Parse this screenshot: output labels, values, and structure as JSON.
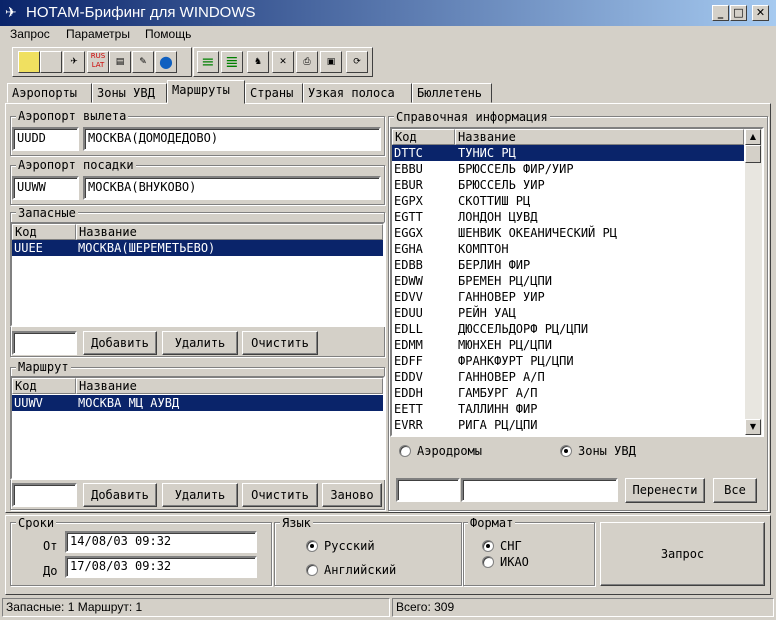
{
  "window": {
    "title": "НОТАМ-Брифинг для WINDOWS",
    "min": "_",
    "max": "□",
    "close": "✕"
  },
  "menu": [
    "Запрос",
    "Параметры",
    "Помощь"
  ],
  "toolbar": [
    {
      "name": "new-icon",
      "glyph": ""
    },
    {
      "name": "save-icon",
      "glyph": ""
    },
    {
      "name": "plane-icon",
      "glyph": "✈"
    },
    {
      "name": "rus-lat-icon",
      "glyph": "RUS LAT"
    },
    {
      "name": "notepad-icon",
      "glyph": "▤"
    },
    {
      "name": "edit-icon",
      "glyph": "✎"
    },
    {
      "name": "globe-icon",
      "glyph": "●"
    },
    {
      "name": "list-green-icon",
      "glyph": "≡"
    },
    {
      "name": "list-green-2-icon",
      "glyph": "≣"
    },
    {
      "name": "chess-icon",
      "glyph": "♞"
    },
    {
      "name": "delete-icon",
      "glyph": "✕"
    },
    {
      "name": "print-icon",
      "glyph": "⎙"
    },
    {
      "name": "disk-icon",
      "glyph": "▣"
    },
    {
      "name": "refresh-icon",
      "glyph": "⟳"
    }
  ],
  "tabs": [
    "Аэропорты",
    "Зоны УВД",
    "Маршруты",
    "Страны",
    "Узкая полоса",
    "Бюллетень"
  ],
  "active_tab": 2,
  "departure": {
    "label": "Аэропорт вылета",
    "code": "UUDD",
    "name": "МОСКВА(ДОМОДЕДОВО)"
  },
  "arrival": {
    "label": "Аэропорт посадки",
    "code": "UUWW",
    "name": "МОСКВА(ВНУКОВО)"
  },
  "alternates": {
    "label": "Запасные",
    "col_code": "Код",
    "col_name": "Название",
    "rows": [
      {
        "code": "UUEE",
        "name": "МОСКВА(ШЕРЕМЕТЬЕВО)"
      }
    ],
    "input": "",
    "btn_add": "Добавить",
    "btn_delete": "Удалить",
    "btn_clear": "Очистить"
  },
  "route": {
    "label": "Маршрут",
    "col_code": "Код",
    "col_name": "Название",
    "rows": [
      {
        "code": "UUWV",
        "name": "МОСКВА МЦ АУВД"
      }
    ],
    "input": "",
    "btn_add": "Добавить",
    "btn_delete": "Удалить",
    "btn_clear": "Очистить",
    "btn_again": "Заново"
  },
  "reference": {
    "label": "Справочная информация",
    "col_code": "Код",
    "col_name": "Название",
    "rows": [
      {
        "code": "DTTC",
        "name": "ТУНИС РЦ"
      },
      {
        "code": "EBBU",
        "name": "БРЮССЕЛЬ ФИР/УИР"
      },
      {
        "code": "EBUR",
        "name": "БРЮССЕЛЬ УИР"
      },
      {
        "code": "EGPX",
        "name": "СКОТТИШ РЦ"
      },
      {
        "code": "EGTT",
        "name": "ЛОНДОН ЦУВД"
      },
      {
        "code": "EGGX",
        "name": "ШЕНВИК ОКЕАНИЧЕСКИЙ РЦ"
      },
      {
        "code": "EGHA",
        "name": "КОМПТОН"
      },
      {
        "code": "EDBB",
        "name": "БЕРЛИН ФИР"
      },
      {
        "code": "EDWW",
        "name": "БРЕМЕН РЦ/ЦПИ"
      },
      {
        "code": "EDVV",
        "name": "ГАННОВЕР УИР"
      },
      {
        "code": "EDUU",
        "name": "РЕЙН УАЦ"
      },
      {
        "code": "EDLL",
        "name": "ДЮССЕЛЬДОРФ РЦ/ЦПИ"
      },
      {
        "code": "EDMM",
        "name": "МЮНХЕН РЦ/ЦПИ"
      },
      {
        "code": "EDFF",
        "name": "ФРАНКФУРТ РЦ/ЦПИ"
      },
      {
        "code": "EDDV",
        "name": "ГАННОВЕР А/П"
      },
      {
        "code": "EDDH",
        "name": "ГАМБУРГ А/П"
      },
      {
        "code": "EETT",
        "name": "ТАЛЛИНН ФИР"
      },
      {
        "code": "EVRR",
        "name": "РИГА РЦ/ЦПИ"
      }
    ],
    "radio_airports": "Аэродромы",
    "radio_zones": "Зоны УВД",
    "selected_radio": "zones",
    "input_code": "",
    "input_name": "",
    "btn_move": "Перенести",
    "btn_all": "Все"
  },
  "terms": {
    "label": "Сроки",
    "from_label": "От",
    "from": "14/08/03 09:32",
    "to_label": "До",
    "to": "17/08/03 09:32"
  },
  "language": {
    "label": "Язык",
    "russian": "Русский",
    "english": "Английский",
    "selected": "russian"
  },
  "format": {
    "label": "Формат",
    "cis": "СНГ",
    "icao": "ИКАО",
    "selected": "cis"
  },
  "request_button": "Запрос",
  "status": {
    "left": "Запасные: 1 Маршрут: 1",
    "right": "Всего: 309"
  }
}
